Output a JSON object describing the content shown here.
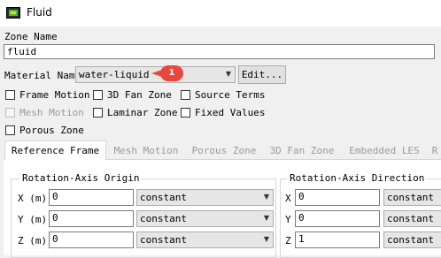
{
  "window": {
    "title": "Fluid"
  },
  "zone": {
    "label": "Zone Name",
    "value": "fluid"
  },
  "material": {
    "label": "Material Name",
    "value": "water-liquid",
    "edit_label": "Edit...",
    "callout": "1",
    "callout_color": "#e8473d"
  },
  "options": [
    {
      "label": "Frame Motion",
      "checked": false,
      "enabled": true
    },
    {
      "label": "3D Fan Zone",
      "checked": false,
      "enabled": true
    },
    {
      "label": "Source Terms",
      "checked": false,
      "enabled": true
    },
    {
      "label": "Mesh Motion",
      "checked": false,
      "enabled": false
    },
    {
      "label": "Laminar Zone",
      "checked": false,
      "enabled": true
    },
    {
      "label": "Fixed Values",
      "checked": false,
      "enabled": true
    },
    {
      "label": "Porous Zone",
      "checked": false,
      "enabled": true
    }
  ],
  "tabs": [
    "Reference Frame",
    "Mesh Motion",
    "Porous Zone",
    "3D Fan Zone",
    "Embedded LES",
    "R"
  ],
  "origin": {
    "title": "Rotation-Axis Origin",
    "rows": [
      {
        "label": "X (m)",
        "value": "0",
        "method": "constant"
      },
      {
        "label": "Y (m)",
        "value": "0",
        "method": "constant"
      },
      {
        "label": "Z (m)",
        "value": "0",
        "method": "constant"
      }
    ]
  },
  "direction": {
    "title": "Rotation-Axis Direction",
    "rows": [
      {
        "label": "X",
        "value": "0",
        "method": "constant"
      },
      {
        "label": "Y",
        "value": "0",
        "method": "constant"
      },
      {
        "label": "Z",
        "value": "1",
        "method": "constant"
      }
    ]
  }
}
